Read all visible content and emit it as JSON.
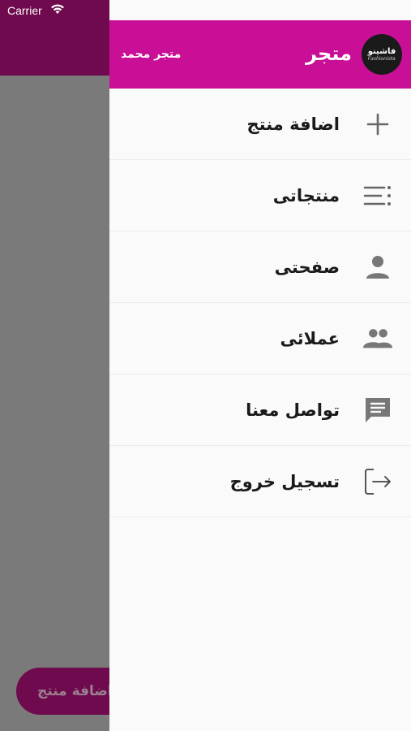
{
  "status_bar": {
    "carrier": "Carrier"
  },
  "background": {
    "fab_label": "اضافة منتج"
  },
  "drawer": {
    "header": {
      "store_name": "متجر",
      "owner_name": "متجر محمد",
      "logo_text": "فاشينو",
      "logo_subtext": "Fashionista"
    },
    "menu": [
      {
        "label": "اضافة منتج",
        "icon": "plus-icon"
      },
      {
        "label": "منتجاتى",
        "icon": "list-icon"
      },
      {
        "label": "صفحتى",
        "icon": "person-icon"
      },
      {
        "label": "عملائى",
        "icon": "people-icon"
      },
      {
        "label": "تواصل معنا",
        "icon": "chat-icon"
      },
      {
        "label": "تسجيل خروج",
        "icon": "logout-icon"
      }
    ]
  },
  "colors": {
    "header": "#c80f96",
    "appbar": "#6e0a4d",
    "scrim": "#7a7a7a",
    "icon": "#555555"
  }
}
